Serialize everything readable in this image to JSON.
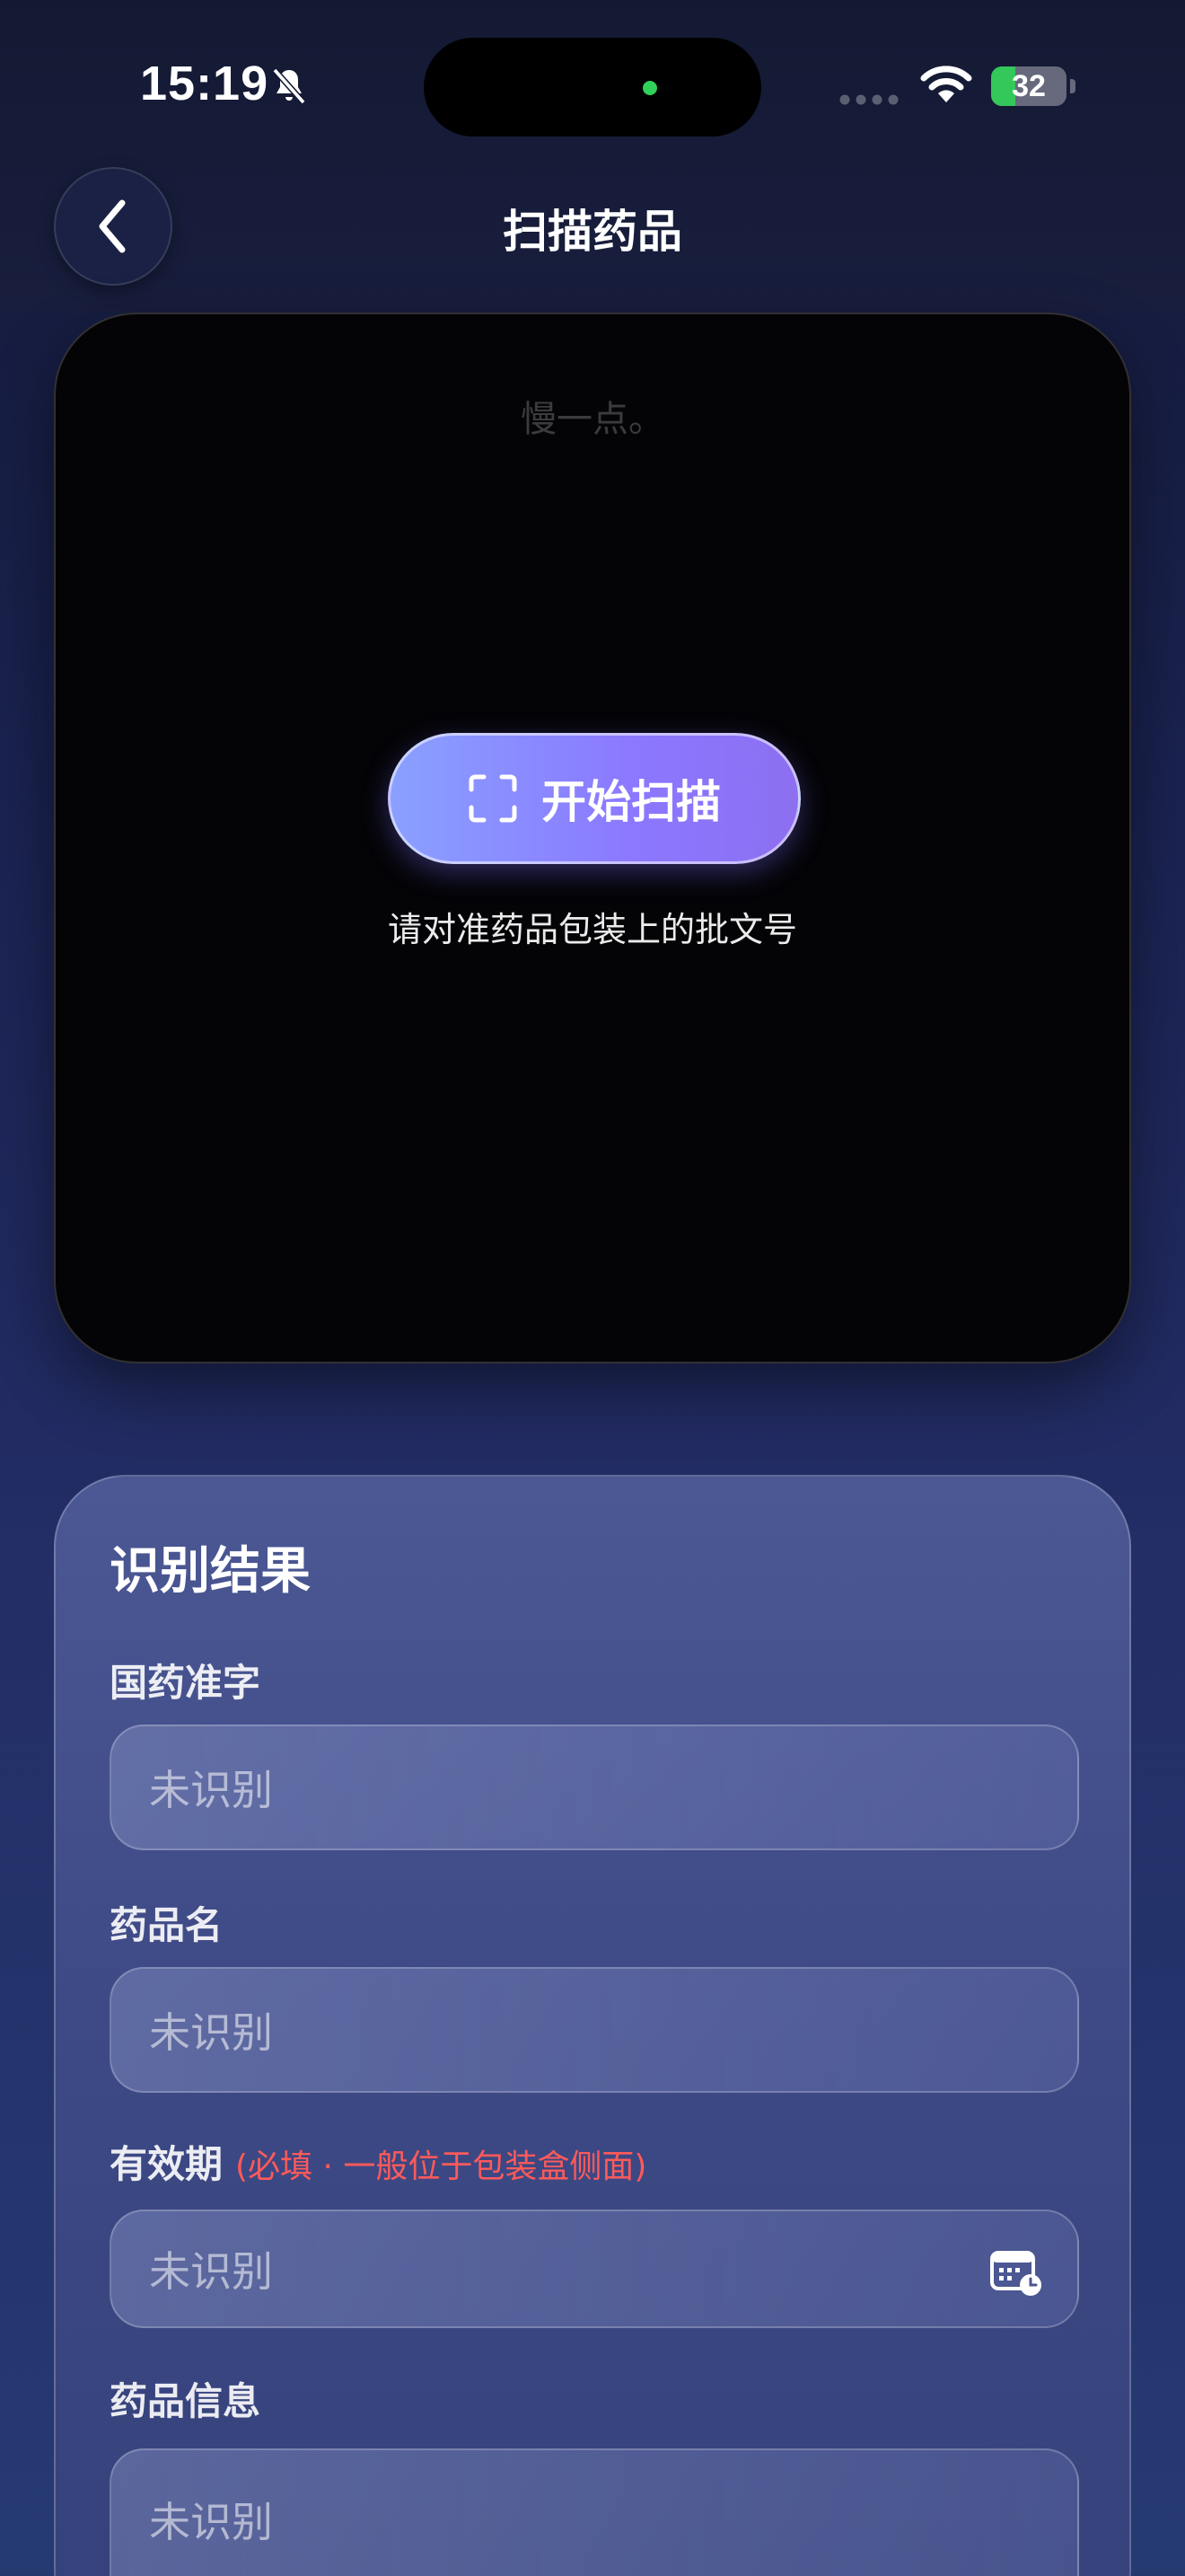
{
  "status_bar": {
    "time": "15:19",
    "battery_percent": 32,
    "battery_label": "32",
    "icons": [
      "bell-slash-icon",
      "cellular-signal-icon",
      "wifi-icon",
      "battery-charging-icon"
    ]
  },
  "nav": {
    "title": "扫描药品",
    "back_icon": "chevron-left-icon"
  },
  "scanner": {
    "hint": "慢一点。",
    "start_button_label": "开始扫描",
    "start_button_icon": "scan-frame-icon",
    "instruction": "请对准药品包装上的批文号"
  },
  "results": {
    "title": "识别结果",
    "fields": [
      {
        "label": "国药准字",
        "value": "未识别"
      },
      {
        "label": "药品名",
        "value": "未识别"
      },
      {
        "label": "有效期",
        "note": "(必填 · 一般位于包装盒侧面)",
        "value": "未识别",
        "icon": "calendar-clock-icon"
      },
      {
        "label": "药品信息",
        "value": "未识别"
      }
    ]
  },
  "colors": {
    "accent_gradient_start": "#8aa0ff",
    "accent_gradient_end": "#8d6ff0",
    "required_red": "#ff5a5a",
    "battery_green": "#34c759"
  }
}
